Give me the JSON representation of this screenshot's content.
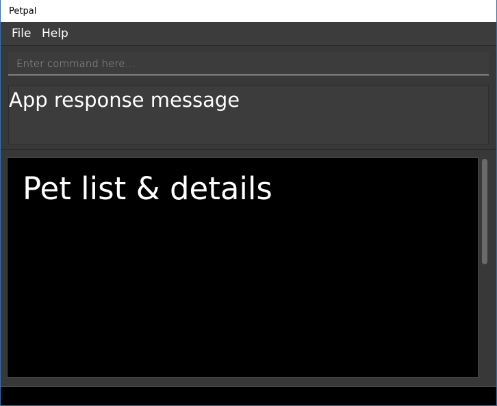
{
  "window": {
    "title": "Petpal"
  },
  "menu": {
    "items": [
      {
        "label": "File"
      },
      {
        "label": "Help"
      }
    ]
  },
  "command": {
    "placeholder": "Enter command here...",
    "value": ""
  },
  "response": {
    "message": "App response message"
  },
  "list_panel": {
    "title": "Pet list & details"
  },
  "status_bar": {
    "text": ""
  },
  "colors": {
    "background": "#383838",
    "panel": "#3c3c3c",
    "list_background": "#000000",
    "text": "#ffffff"
  }
}
